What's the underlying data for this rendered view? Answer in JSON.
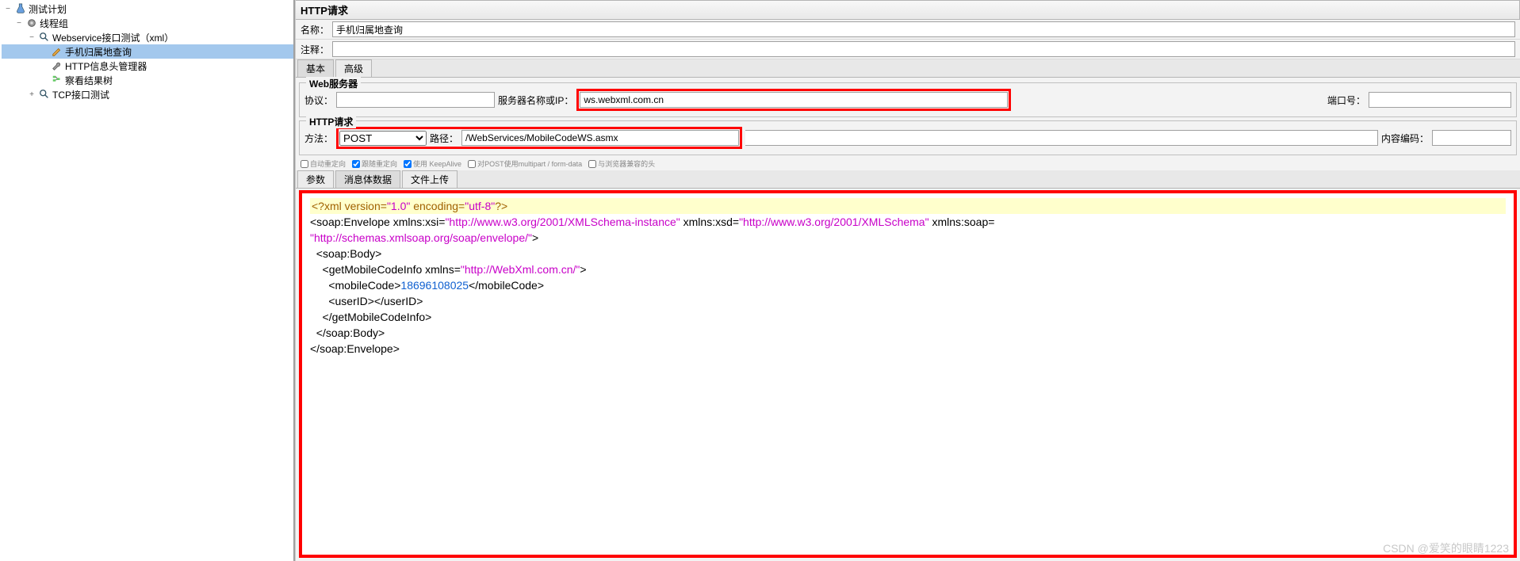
{
  "tree": {
    "root": "测试计划",
    "thread_group": "线程组",
    "webservice": "Webservice接口测试（xml）",
    "mobile_query": "手机归属地查询",
    "http_header": "HTTP信息头管理器",
    "view_results": "察看结果树",
    "tcp_test": "TCP接口测试"
  },
  "main": {
    "title": "HTTP请求",
    "name_label": "名称：",
    "name_value": "手机归属地查询",
    "comment_label": "注释：",
    "comment_value": "",
    "tabs": {
      "basic": "基本",
      "advanced": "高级"
    },
    "web_server": {
      "legend": "Web服务器",
      "protocol_label": "协议：",
      "protocol_value": "",
      "server_label": "服务器名称或IP：",
      "server_value": "ws.webxml.com.cn",
      "port_label": "端口号：",
      "port_value": ""
    },
    "http_request": {
      "legend": "HTTP请求",
      "method_label": "方法：",
      "method_value": "POST",
      "path_label": "路径：",
      "path_value": "/WebServices/MobileCodeWS.asmx",
      "encoding_label": "内容编码：",
      "encoding_value": ""
    },
    "checkboxes": {
      "auto_redirect": "自动重定向",
      "follow_redirect": "跟随重定向",
      "keepalive": "使用 KeepAlive",
      "multipart": "对POST使用multipart / form-data",
      "browser_compat": "与浏览器兼容的头"
    },
    "body_tabs": {
      "params": "参数",
      "body": "消息体数据",
      "upload": "文件上传"
    },
    "xml_body": {
      "decl_prefix": "<?xml version=",
      "decl_version": "\"1.0\"",
      "decl_enc_label": " encoding=",
      "decl_enc": "\"utf-8\"",
      "decl_suffix": "?>",
      "env_open1": "<soap:Envelope xmlns:xsi=",
      "xsi": "\"http://www.w3.org/2001/XMLSchema-instance\"",
      "env_open2": " xmlns:xsd=",
      "xsd": "\"http://www.w3.org/2001/XMLSchema\"",
      "env_open3": " xmlns:soap=",
      "soapns": "\"http://schemas.xmlsoap.org/soap/envelope/\"",
      "env_close": ">",
      "body_open": "  <soap:Body>",
      "getinfo_open1": "    <getMobileCodeInfo xmlns=",
      "getinfo_ns": "\"http://WebXml.com.cn/\"",
      "getinfo_open2": ">",
      "mobile_open": "      <mobileCode>",
      "mobile_val": "18696108025",
      "mobile_close": "</mobileCode>",
      "userid": "      <userID></userID>",
      "getinfo_close": "    </getMobileCodeInfo>",
      "body_close": "  </soap:Body>",
      "env_end": "</soap:Envelope>"
    }
  },
  "watermark": "CSDN @爱笑的眼睛1223"
}
